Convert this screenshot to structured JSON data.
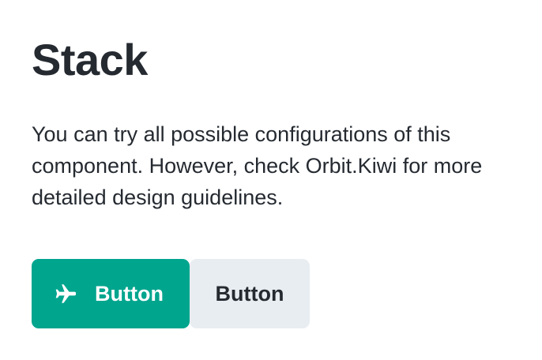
{
  "header": {
    "title": "Stack"
  },
  "main": {
    "description": "You can try all possible configurations of this component. However, check Orbit.Kiwi for more detailed design guidelines."
  },
  "stack": {
    "primary_button": {
      "label": "Button",
      "icon": "airplane-icon"
    },
    "secondary_button": {
      "label": "Button"
    }
  },
  "colors": {
    "primary": "#00a58e",
    "secondary_bg": "#e8edf1",
    "text": "#252a31"
  }
}
